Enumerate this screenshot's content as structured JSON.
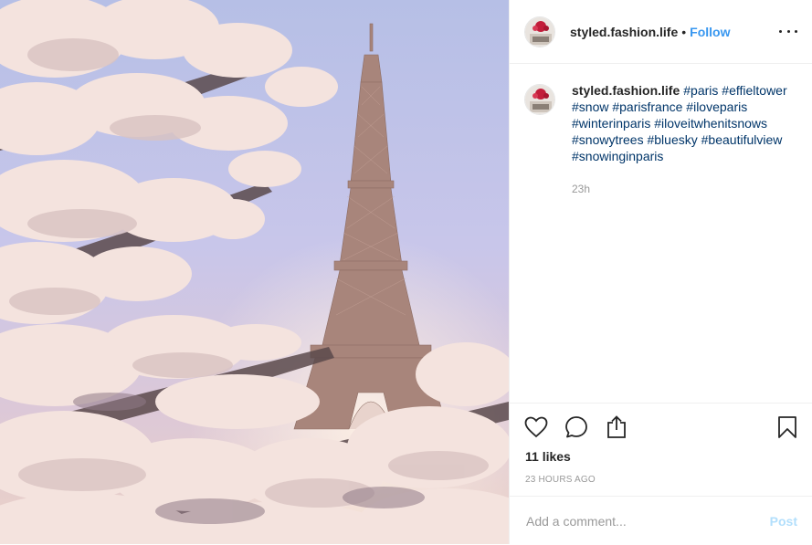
{
  "post": {
    "image_alt": "Eiffel Tower behind snowy tree branches",
    "username": "styled.fashion.life",
    "follow_label": "Follow",
    "separator": "•",
    "more_icon": "more-horizontal-icon"
  },
  "caption": {
    "username": "styled.fashion.life",
    "hashtags": [
      "#paris",
      "#effieltower",
      "#snow",
      "#parisfrance",
      "#iloveparis",
      "#winterinparis",
      "#iloveitwhenitsnows",
      "#snowytrees",
      "#bluesky",
      "#beautifulview",
      "#snowinginparis"
    ],
    "time": "23h"
  },
  "actions": {
    "like_icon": "heart-icon",
    "comment_icon": "comment-icon",
    "share_icon": "share-icon",
    "save_icon": "bookmark-icon"
  },
  "likes": "11 likes",
  "timestamp": "23 HOURS AGO",
  "comment": {
    "placeholder": "Add a comment...",
    "value": "",
    "post_label": "Post"
  },
  "colors": {
    "link": "#3897f0",
    "hashtag": "#003569",
    "post_disabled": "#b2dffc",
    "muted": "#999999",
    "border": "#efefef"
  }
}
